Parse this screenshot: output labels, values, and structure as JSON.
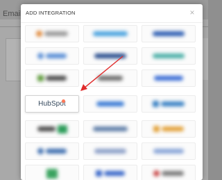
{
  "background": {
    "page_title": "Email S"
  },
  "modal": {
    "title": "ADD INTEGRATION",
    "close_symbol": "×"
  },
  "integrations": [
    {
      "name": "",
      "blurred": true,
      "logo_color": "#e08a3c"
    },
    {
      "name": "",
      "blurred": true,
      "logo_color": "#4aa3df"
    },
    {
      "name": "",
      "blurred": true,
      "logo_color": "#2f5fb3"
    },
    {
      "name": "",
      "blurred": true,
      "logo_color": "#5a8fd6"
    },
    {
      "name": "",
      "blurred": true,
      "logo_color": "#2b4f8f"
    },
    {
      "name": "",
      "blurred": true,
      "logo_color": "#4cb0a8"
    },
    {
      "name": "",
      "blurred": true,
      "logo_color": "#5f9b3c"
    },
    {
      "name": "",
      "blurred": true,
      "logo_color": "#6c6c6c"
    },
    {
      "name": "",
      "blurred": true,
      "logo_color": "#3d6fd6"
    },
    {
      "name": "HubSpot",
      "blurred": false,
      "logo_color": "#ff7a59",
      "highlighted": true
    },
    {
      "name": "",
      "blurred": true,
      "logo_color": "#3a7bd5"
    },
    {
      "name": "",
      "blurred": true,
      "logo_color": "#3a82c4"
    },
    {
      "name": "",
      "blurred": true,
      "logo_color": "#2c9c5a"
    },
    {
      "name": "",
      "blurred": true,
      "logo_color": "#5f7ea8"
    },
    {
      "name": "",
      "blurred": true,
      "logo_color": "#e3a23a"
    },
    {
      "name": "",
      "blurred": true,
      "logo_color": "#3f6fb0"
    },
    {
      "name": "",
      "blurred": true,
      "logo_color": "#8da0c8"
    },
    {
      "name": "",
      "blurred": true,
      "logo_color": "#8aa6d8"
    },
    {
      "name": "",
      "blurred": true,
      "logo_color": "#3aa35f"
    },
    {
      "name": "",
      "blurred": true,
      "logo_color": "#3a68c9"
    },
    {
      "name": "",
      "blurred": true,
      "logo_color": "#c94a4a"
    }
  ],
  "annotation": {
    "arrow_color": "#e02b2b"
  }
}
